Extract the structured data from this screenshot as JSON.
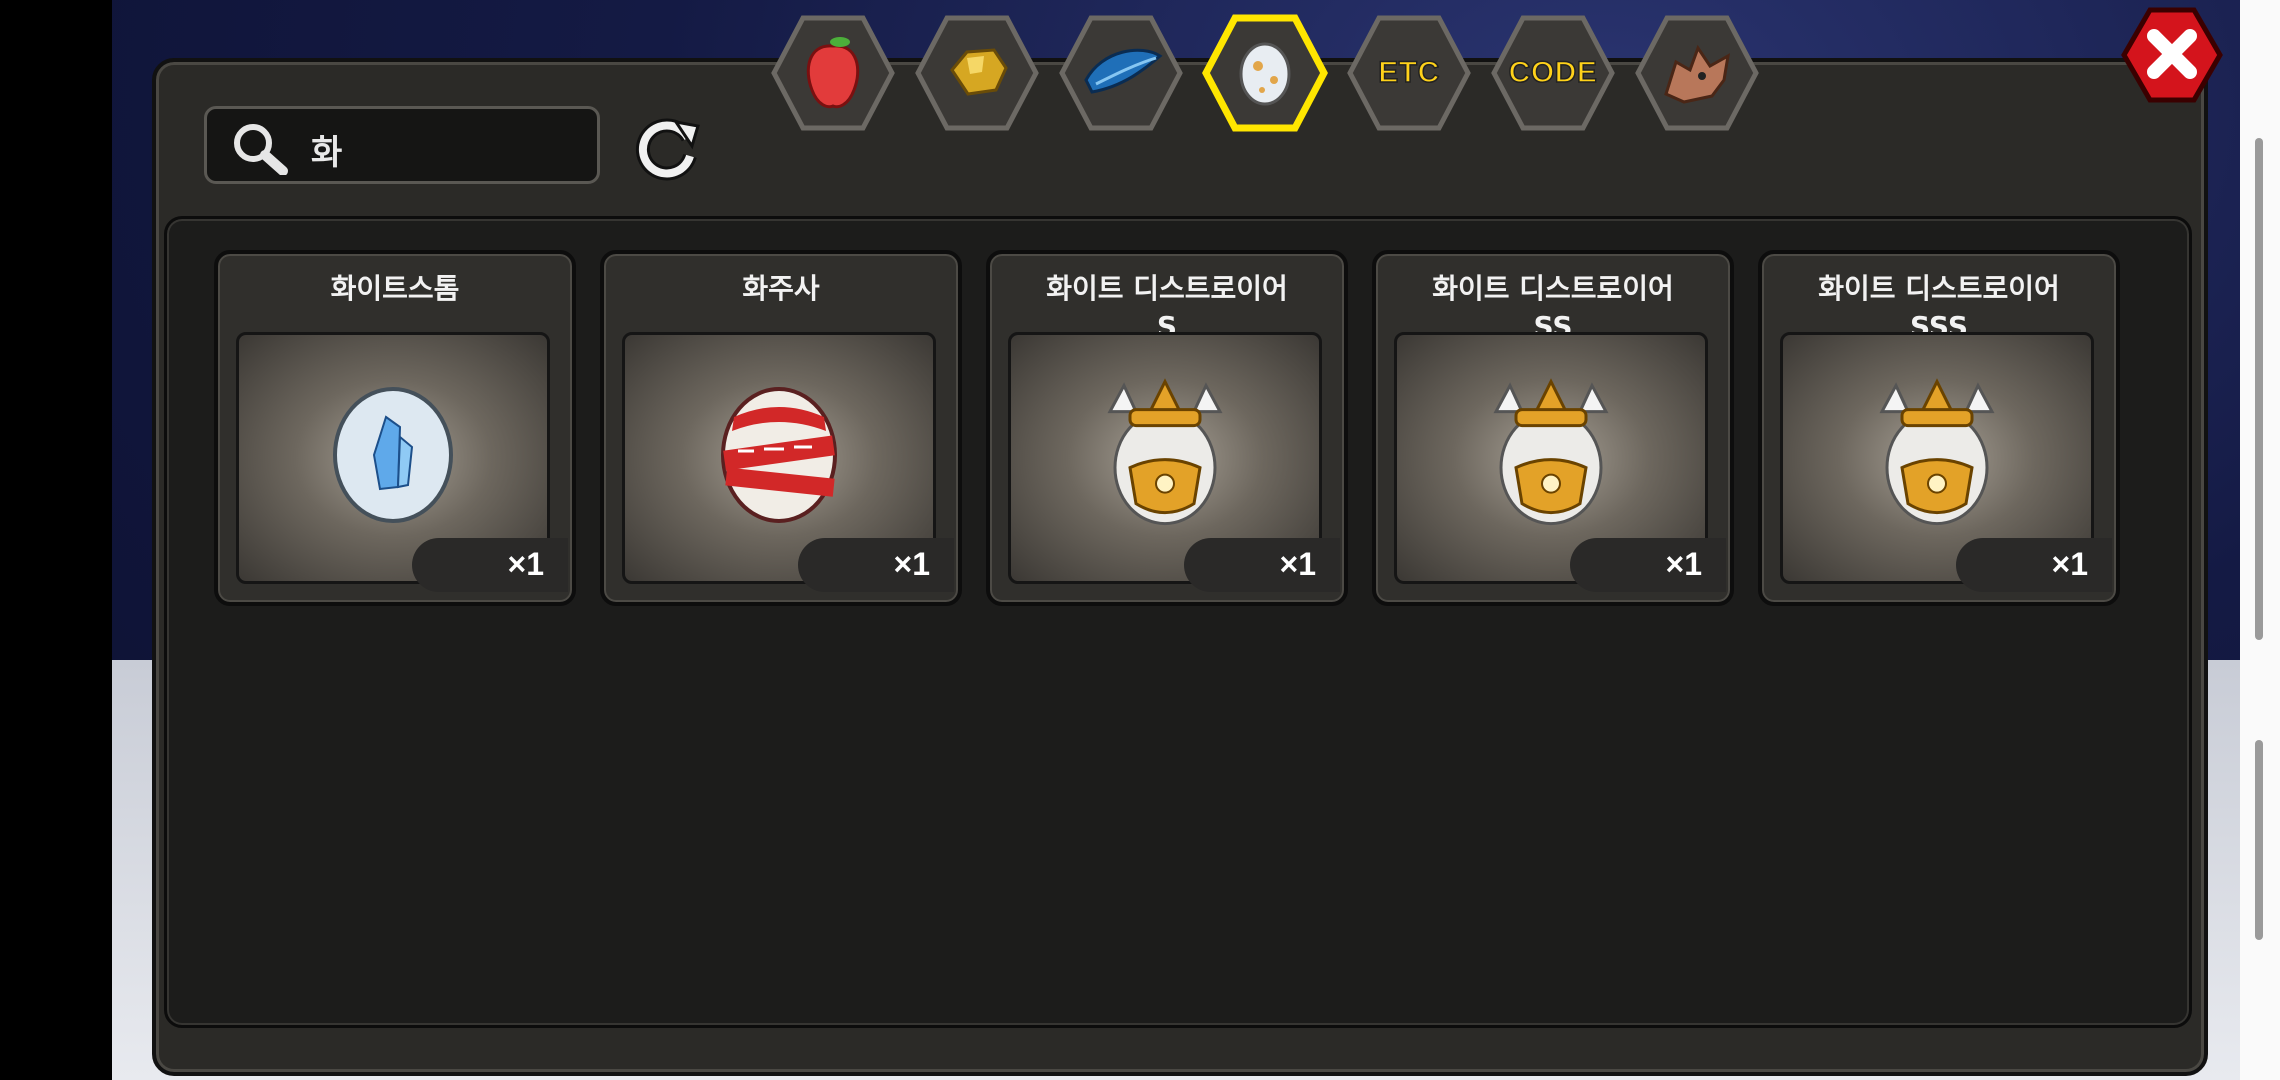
{
  "search": {
    "value": "화"
  },
  "tabs": [
    {
      "name": "fruit",
      "icon": "fruit-icon",
      "label": ""
    },
    {
      "name": "gold-ore",
      "icon": "gold-ore-icon",
      "label": ""
    },
    {
      "name": "feather",
      "icon": "blue-feather-icon",
      "label": ""
    },
    {
      "name": "egg",
      "icon": "egg-icon",
      "label": "",
      "selected": true
    },
    {
      "name": "etc",
      "icon": "",
      "label": "ETC"
    },
    {
      "name": "code",
      "icon": "",
      "label": "CODE"
    },
    {
      "name": "dragon",
      "icon": "dragon-head-icon",
      "label": ""
    }
  ],
  "items": [
    {
      "name_line1": "화이트스톰",
      "name_line2": "",
      "qty": "×1",
      "icon": "ice-crystal-egg-icon"
    },
    {
      "name_line1": "화주사",
      "name_line2": "",
      "qty": "×1",
      "icon": "bandaged-red-egg-icon"
    },
    {
      "name_line1": "화이트 디스트로이어",
      "name_line2": "S",
      "qty": "×1",
      "icon": "armored-egg-icon"
    },
    {
      "name_line1": "화이트 디스트로이어",
      "name_line2": "SS",
      "qty": "×1",
      "icon": "armored-egg-icon"
    },
    {
      "name_line1": "화이트 디스트로이어",
      "name_line2": "SSS",
      "qty": "×1",
      "icon": "armored-egg-icon"
    }
  ],
  "colors": {
    "tab_label": "#ffd21a",
    "selected_tab_border": "#ffe600",
    "close_red": "#d4141c"
  }
}
